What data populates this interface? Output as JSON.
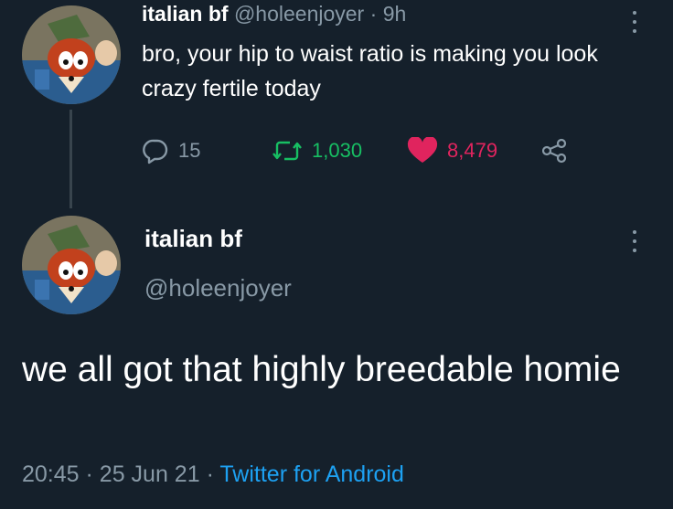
{
  "tweet1": {
    "author_name": "italian bf",
    "handle": "@holeenjoyer",
    "separator": "·",
    "time": "9h",
    "text": "bro, your hip to waist ratio is making you look crazy fertile today",
    "replies": "15",
    "retweets": "1,030",
    "likes": "8,479",
    "icons": {
      "reply": "reply-bubble-icon",
      "retweet": "retweet-icon",
      "like": "heart-icon",
      "share": "share-icon",
      "more": "more-options-icon"
    }
  },
  "tweet2": {
    "author_name": "italian bf",
    "handle": "@holeenjoyer",
    "text": "we all got that highly breedable homie",
    "time": "20:45",
    "separator": "·",
    "date": "25 Jun 21",
    "source": "Twitter for Android"
  },
  "colors": {
    "background": "#15202b",
    "muted_text": "#8899a6",
    "retweet_green": "#17bf63",
    "like_pink": "#e0245e",
    "link_blue": "#1da1f2"
  }
}
